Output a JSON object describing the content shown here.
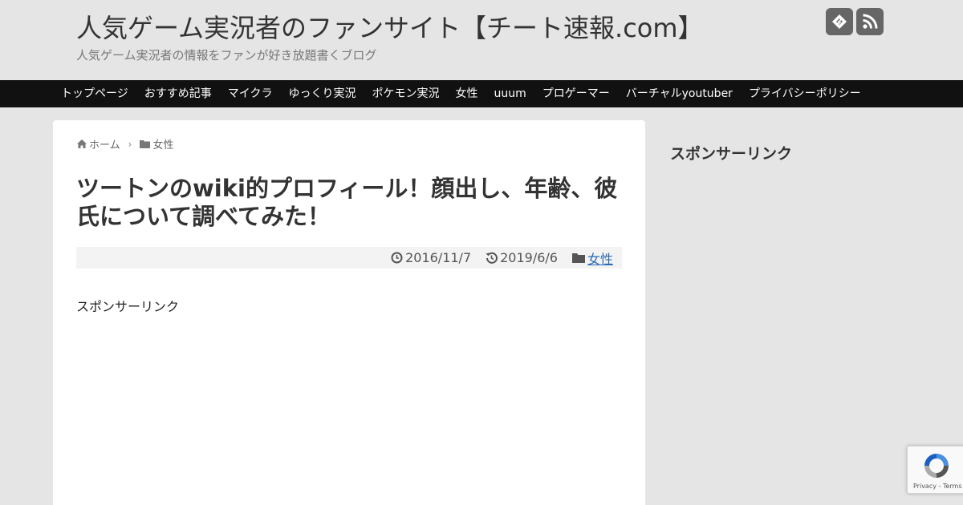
{
  "header": {
    "site_title": "人気ゲーム実況者のファンサイト【チート速報.com】",
    "site_description": "人気ゲーム実況者の情報をファンが好き放題書くブログ",
    "social_icons": [
      "feedly-icon",
      "rss-icon"
    ]
  },
  "nav": {
    "items": [
      {
        "label": "トップページ"
      },
      {
        "label": "おすすめ記事"
      },
      {
        "label": "マイクラ"
      },
      {
        "label": "ゆっくり実況"
      },
      {
        "label": "ポケモン実況"
      },
      {
        "label": "女性"
      },
      {
        "label": "uuum"
      },
      {
        "label": "プロゲーマー"
      },
      {
        "label": "バーチャルyoutuber"
      },
      {
        "label": "プライバシーポリシー"
      }
    ]
  },
  "breadcrumb": {
    "home": "ホーム",
    "category": "女性"
  },
  "post": {
    "title": "ツートンのwiki的プロフィール！顔出し、年齢、彼氏について調べてみた！",
    "published": "2016/11/7",
    "updated": "2019/6/6",
    "category": "女性",
    "sponsor_label": "スポンサーリンク"
  },
  "sidebar": {
    "title": "スポンサーリンク"
  },
  "recaptcha": {
    "links": "Privacy - Terms"
  },
  "colors": {
    "background": "#e5e5e5",
    "navbar": "#111111",
    "link": "#2a6ab5",
    "icon_bg": "#666666"
  }
}
